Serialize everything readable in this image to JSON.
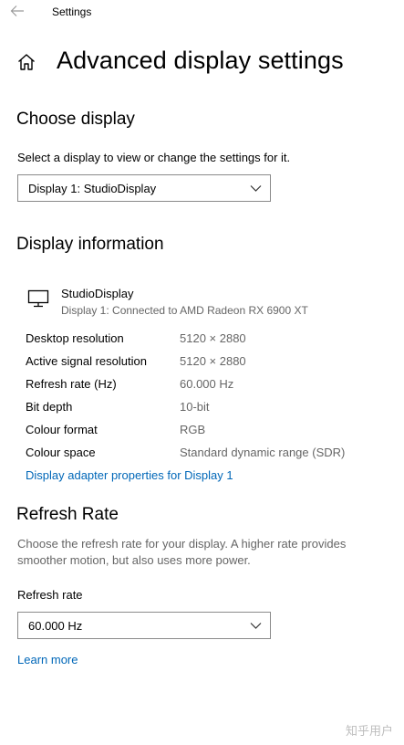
{
  "window": {
    "app_title": "Settings"
  },
  "page": {
    "title": "Advanced display settings"
  },
  "choose_display": {
    "heading": "Choose display",
    "description": "Select a display to view or change the settings for it.",
    "selected": "Display 1: StudioDisplay"
  },
  "display_info": {
    "heading": "Display information",
    "monitor_name": "StudioDisplay",
    "monitor_subtitle": "Display 1: Connected to AMD Radeon RX 6900 XT",
    "rows": [
      {
        "label": "Desktop resolution",
        "value": "5120 × 2880"
      },
      {
        "label": "Active signal resolution",
        "value": "5120 × 2880"
      },
      {
        "label": "Refresh rate (Hz)",
        "value": "60.000 Hz"
      },
      {
        "label": "Bit depth",
        "value": "10-bit"
      },
      {
        "label": "Colour format",
        "value": "RGB"
      },
      {
        "label": "Colour space",
        "value": "Standard dynamic range (SDR)"
      }
    ],
    "adapter_link": "Display adapter properties for Display 1"
  },
  "refresh": {
    "heading": "Refresh Rate",
    "description": "Choose the refresh rate for your display. A higher rate provides smoother motion, but also uses more power.",
    "label": "Refresh rate",
    "selected": "60.000 Hz",
    "learn_more": "Learn more"
  },
  "watermark": "知乎用户",
  "colors": {
    "accent": "#0067b8",
    "secondary_text": "#666666",
    "border": "#8a8a8a"
  }
}
